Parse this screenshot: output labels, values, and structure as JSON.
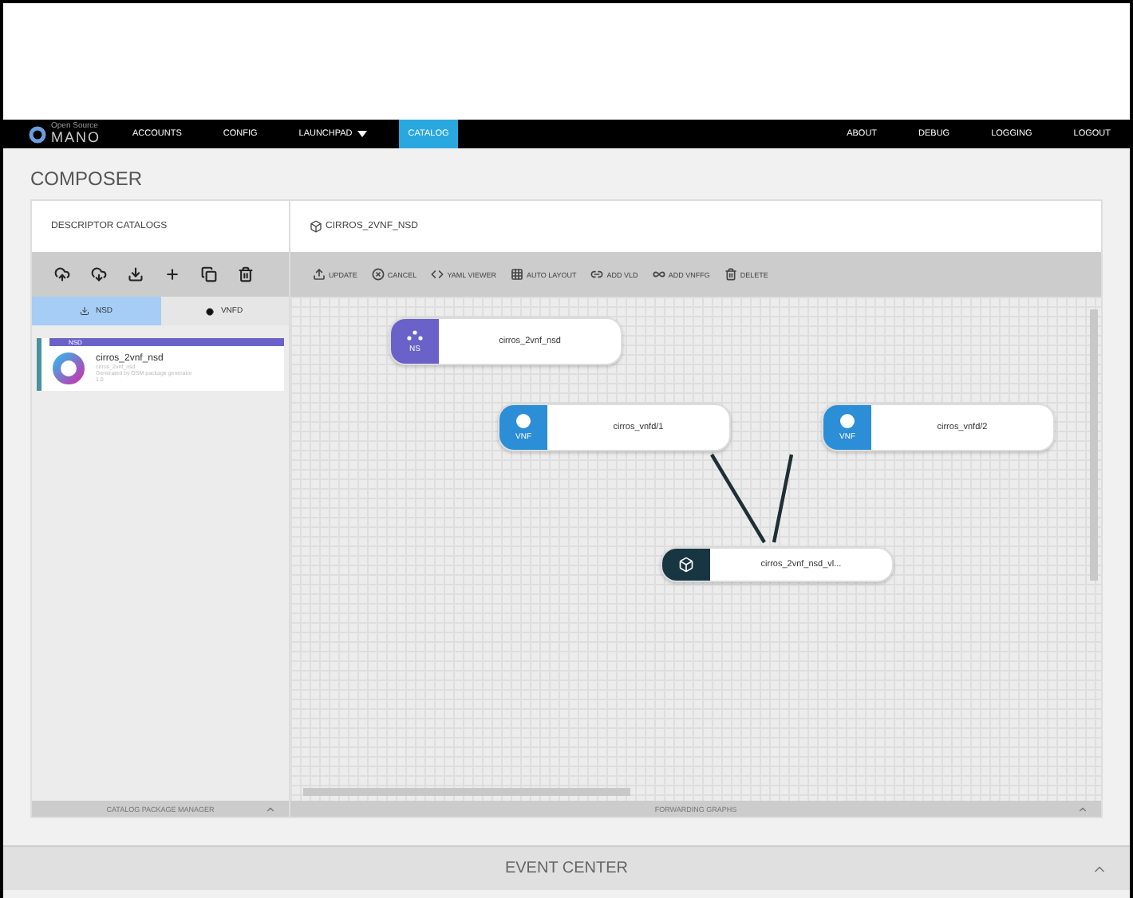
{
  "brand": {
    "tagline": "Open Source",
    "name": "MANO"
  },
  "nav": [
    {
      "label": "ACCOUNTS",
      "selected": false
    },
    {
      "label": "CONFIG",
      "selected": false
    },
    {
      "label": "LAUNCHPAD",
      "selected": false,
      "dropdown": true
    },
    {
      "label": "CATALOG",
      "selected": true
    }
  ],
  "nav_right": [
    "ABOUT",
    "DEBUG",
    "LOGGING",
    "LOGOUT"
  ],
  "page_title": "COMPOSER",
  "catalog_panel": {
    "title": "DESCRIPTOR CATALOGS",
    "tabs": [
      {
        "label": "NSD",
        "selected": true
      },
      {
        "label": "VNFD",
        "selected": false
      }
    ],
    "items": [
      {
        "badge": "NSD",
        "name": "cirros_2vnf_nsd",
        "lines": [
          "cirros_2vnf_nsd",
          "Generated by OSM package generator",
          "1.0"
        ],
        "selected": true
      }
    ],
    "footer": "CATALOG PACKAGE MANAGER"
  },
  "composer_panel": {
    "descriptor": "CIRROS_2VNF_NSD",
    "toolbar": [
      "UPDATE",
      "CANCEL",
      "YAML VIEWER",
      "AUTO LAYOUT",
      "ADD VLD",
      "ADD VNFFG",
      "DELETE"
    ],
    "nodes": [
      {
        "kind": "ns",
        "tag": "NS",
        "label": "cirros_2vnf_nsd"
      },
      {
        "kind": "vnf",
        "tag": "VNF",
        "label": "cirros_vnfd/1"
      },
      {
        "kind": "vnf",
        "tag": "VNF",
        "label": "cirros_vnfd/2"
      },
      {
        "kind": "vld",
        "label": "cirros_2vnf_nsd_vl..."
      }
    ],
    "footer": "FORWARDING GRAPHS"
  },
  "event_center": "EVENT CENTER"
}
